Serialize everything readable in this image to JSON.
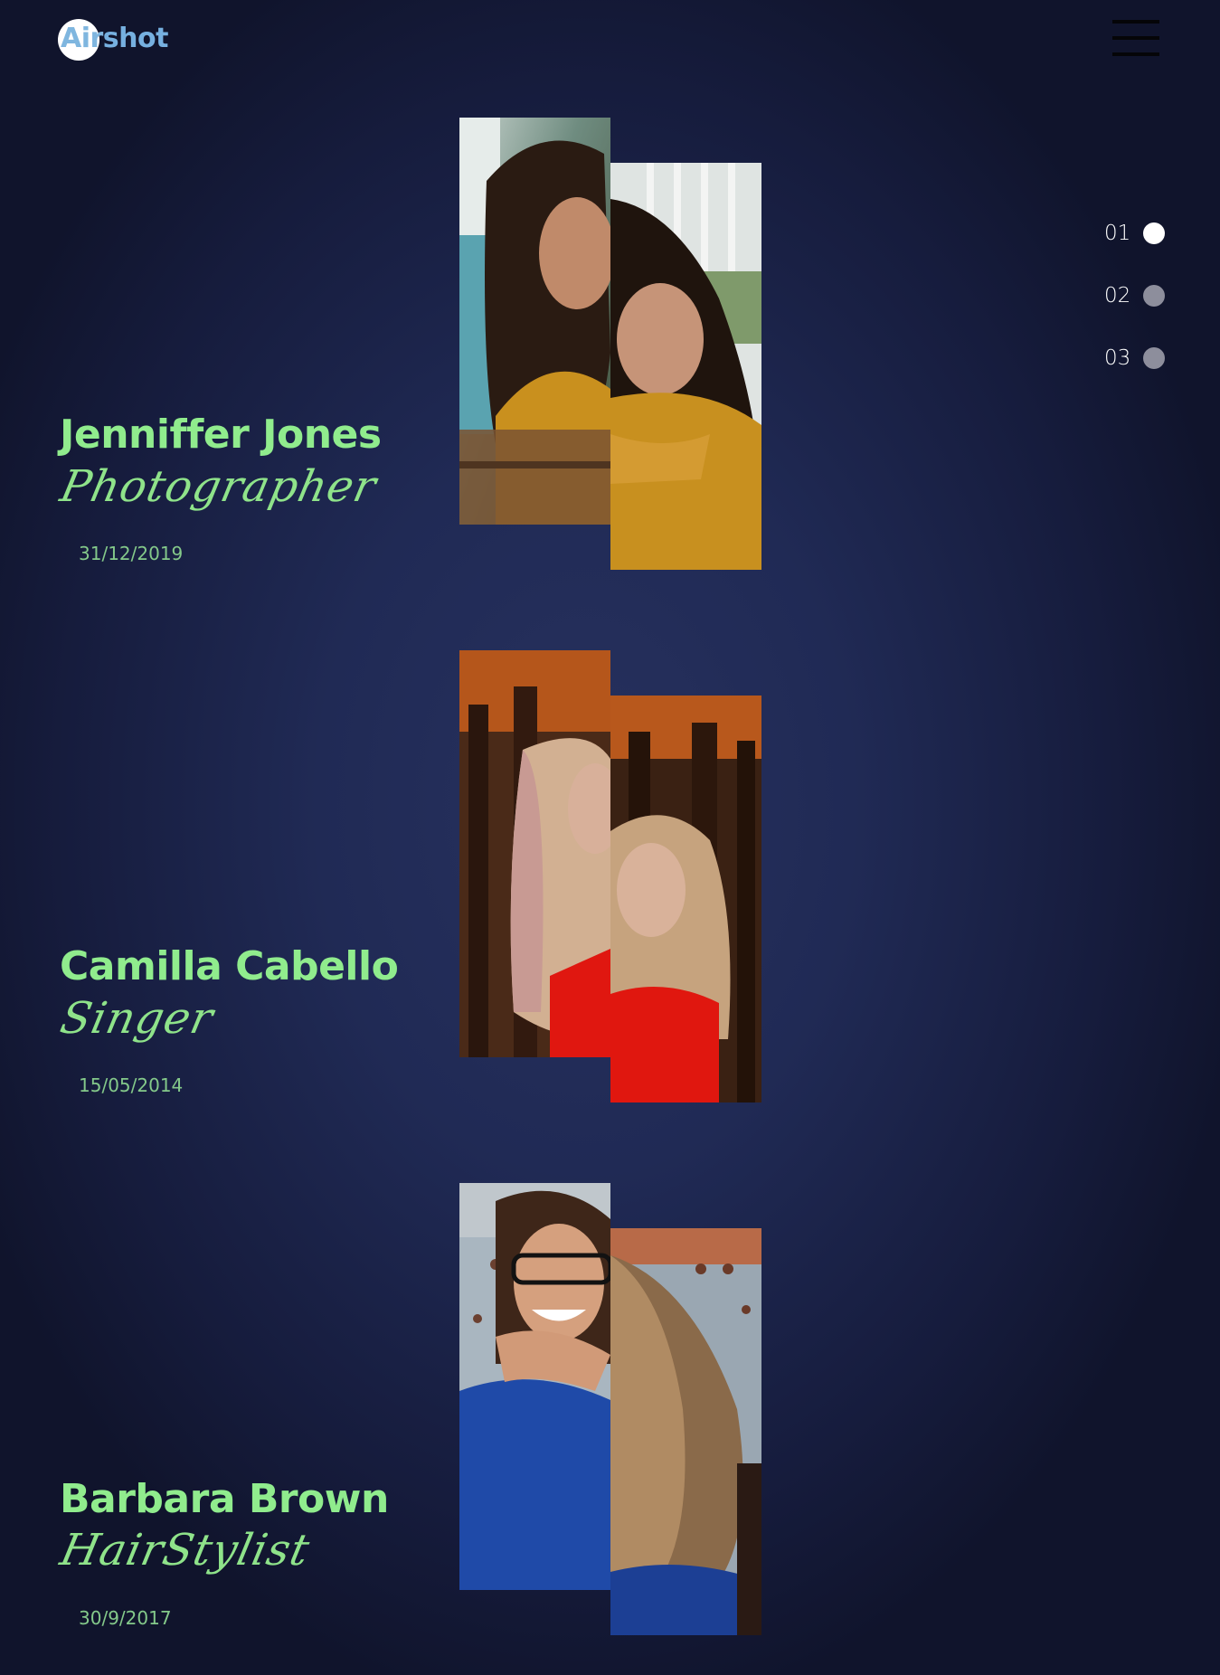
{
  "brand": {
    "part1": "Air",
    "part2": "shot"
  },
  "menu": {
    "icon": "hamburger-menu-icon"
  },
  "pager": [
    {
      "label": "01",
      "active": true
    },
    {
      "label": "02",
      "active": false
    },
    {
      "label": "03",
      "active": false
    }
  ],
  "people": [
    {
      "name": "Jenniffer Jones",
      "role": "Photographer",
      "date": "31/12/2019"
    },
    {
      "name": "Camilla Cabello",
      "role": "Singer",
      "date": "15/05/2014"
    },
    {
      "name": "Barbara Brown",
      "role": "HairStylist",
      "date": "30/9/2017"
    }
  ],
  "colors": {
    "name": "#90ec8d",
    "accent_logo": "#7fb6df",
    "dot_active": "#ffffff",
    "dot_inactive": "#8d8e9c"
  }
}
